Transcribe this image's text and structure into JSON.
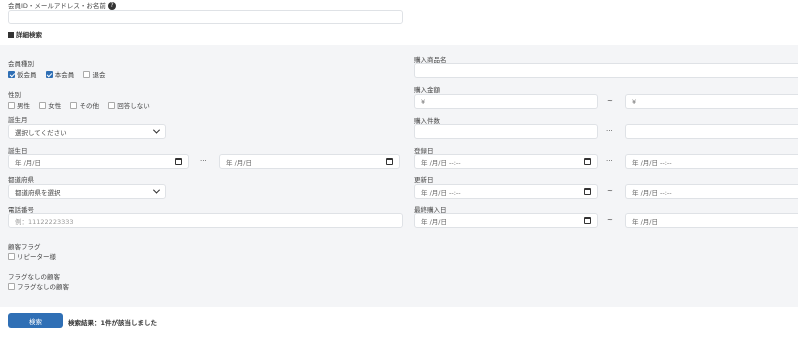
{
  "top": {
    "member_search_label": "会員ID・メールアドレス・お名前",
    "help_icon": "question-circle-icon",
    "member_search_value": "",
    "detail_toggle_label": "詳細検索"
  },
  "left": {
    "member_type": {
      "label": "会員種別",
      "options": [
        {
          "label": "仮会員",
          "checked": true
        },
        {
          "label": "本会員",
          "checked": true
        },
        {
          "label": "退会",
          "checked": false
        }
      ]
    },
    "gender": {
      "label": "性別",
      "options": [
        {
          "label": "男性",
          "checked": false
        },
        {
          "label": "女性",
          "checked": false
        },
        {
          "label": "その他",
          "checked": false
        },
        {
          "label": "回答しない",
          "checked": false
        }
      ]
    },
    "birth_month": {
      "label": "誕生月",
      "selected": "選択してください"
    },
    "birthday": {
      "label": "誕生日",
      "from": "年 /月/日",
      "tilde": "···",
      "to": "年 /月/日"
    },
    "prefecture": {
      "label": "都道府県",
      "selected": "都道府県を選択"
    },
    "phone": {
      "label": "電話番号",
      "placeholder": "例：11122223333"
    },
    "customer_flag": {
      "label": "顧客フラグ",
      "option": "リピーター様"
    },
    "no_flag": {
      "label": "フラグなしの顧客",
      "option": "フラグなしの顧客"
    }
  },
  "right": {
    "product_name": {
      "label": "購入商品名",
      "value": ""
    },
    "purchase_amount": {
      "label": "購入金額",
      "from": "¥",
      "tilde": "~",
      "to": "¥"
    },
    "purchase_count": {
      "label": "購入件数",
      "from": "",
      "tilde": "···",
      "to": ""
    },
    "registered_date": {
      "label": "登録日",
      "from": "年 /月/日 --:--",
      "tilde": "···",
      "to": "年 /月/日 --:--"
    },
    "updated_date": {
      "label": "更新日",
      "from": "年 /月/日 --:--",
      "tilde": "~",
      "to": "年 /月/日 --:--"
    },
    "last_purchase": {
      "label": "最終購入日",
      "from": "年 /月/日",
      "tilde": "~",
      "to": "年 /月/日"
    }
  },
  "footer": {
    "search_button": "検索",
    "result_text": "検索結果：1件が該当しました"
  },
  "colors": {
    "accent": "#2f6fb5",
    "panel_bg": "#f4f5f7",
    "border": "#dfe2e6"
  }
}
